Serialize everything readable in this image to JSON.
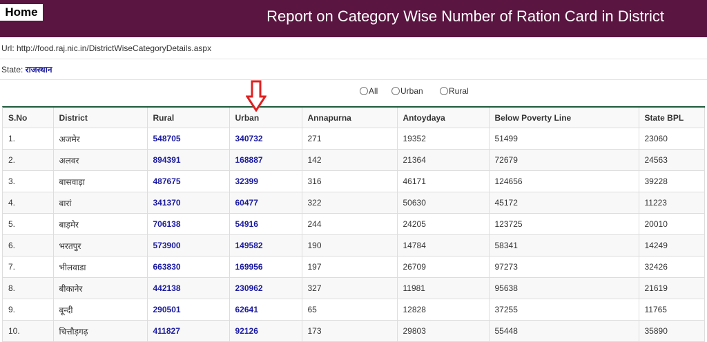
{
  "header": {
    "home_label": "Home",
    "title": "Report on Category Wise Number of Ration Card in District",
    "bg_color": "#5a1541"
  },
  "url_row": {
    "label": "Url: http://food.raj.nic.in/DistrictWiseCategoryDetails.aspx"
  },
  "state_row": {
    "label": "State:",
    "value": "राजस्थान"
  },
  "filters": [
    {
      "label": "All"
    },
    {
      "label": "Urban"
    },
    {
      "label": "Rural"
    }
  ],
  "table": {
    "headers": [
      "S.No",
      "District",
      "Rural",
      "Urban",
      "Annapurna",
      "Antoydaya",
      "Below Poverty Line",
      "State BPL"
    ],
    "rows": [
      [
        "1.",
        "अजमेर",
        "548705",
        "340732",
        "271",
        "19352",
        "51499",
        "23060"
      ],
      [
        "2.",
        "अलवर",
        "894391",
        "168887",
        "142",
        "21364",
        "72679",
        "24563"
      ],
      [
        "3.",
        "बासवाड़ा",
        "487675",
        "32399",
        "316",
        "46171",
        "124656",
        "39228"
      ],
      [
        "4.",
        "बारां",
        "341370",
        "60477",
        "322",
        "50630",
        "45172",
        "11223"
      ],
      [
        "5.",
        "बाड़मेर",
        "706138",
        "54916",
        "244",
        "24205",
        "123725",
        "20010"
      ],
      [
        "6.",
        "भरतपुर",
        "573900",
        "149582",
        "190",
        "14784",
        "58341",
        "14249"
      ],
      [
        "7.",
        "भीलवाडा",
        "663830",
        "169956",
        "197",
        "26709",
        "97273",
        "32426"
      ],
      [
        "8.",
        "बीकानेर",
        "442138",
        "230962",
        "327",
        "11981",
        "95638",
        "21619"
      ],
      [
        "9.",
        "बून्दी",
        "290501",
        "62641",
        "65",
        "12828",
        "37255",
        "11765"
      ],
      [
        "10.",
        "चित्तौड़गढ़",
        "411827",
        "92126",
        "173",
        "29803",
        "55448",
        "35890"
      ]
    ]
  }
}
